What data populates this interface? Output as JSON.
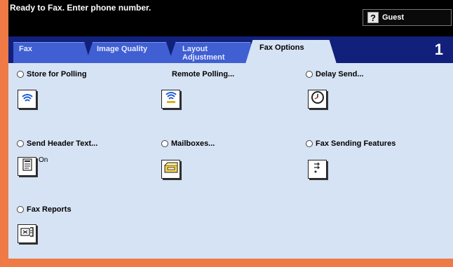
{
  "status": {
    "message": "Ready to Fax. Enter phone number."
  },
  "user": {
    "label": "Guest",
    "icon": "guest-help-icon"
  },
  "tabs": [
    {
      "label": "Fax"
    },
    {
      "label": "Image Quality"
    },
    {
      "label": "Layout Adjustment",
      "line1": "Layout",
      "line2": "Adjustment"
    },
    {
      "label": "Fax Options",
      "active": true
    }
  ],
  "page_number": "1",
  "options": {
    "store_for_polling": {
      "label": "Store for Polling",
      "icon": "polling-store-icon"
    },
    "remote_polling": {
      "label": "Remote Polling...",
      "icon": "remote-polling-icon"
    },
    "delay_send": {
      "label": "Delay Send...",
      "icon": "clock-icon"
    },
    "send_header_text": {
      "label": "Send Header Text...",
      "icon": "header-text-icon",
      "value": "On"
    },
    "mailboxes": {
      "label": "Mailboxes...",
      "icon": "mailbox-icon"
    },
    "fax_sending_features": {
      "label": "Fax Sending Features",
      "icon": "sending-features-icon"
    },
    "fax_reports": {
      "label": "Fax Reports",
      "icon": "fax-report-icon"
    }
  },
  "colors": {
    "frame": "#ef7a45",
    "tab_bar": "#11207a",
    "tab": "#3f5fd2",
    "panel": "#d6e3f4"
  }
}
